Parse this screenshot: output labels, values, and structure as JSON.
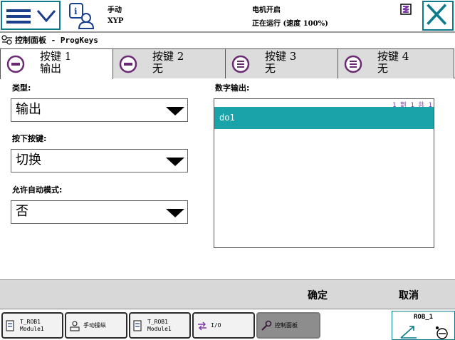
{
  "header": {
    "mode": "手动",
    "tool": "XYP",
    "motor_status": "电机开启",
    "run_status": "正在运行 (速度 100%)"
  },
  "page": {
    "title": "控制面板 - ProgKeys"
  },
  "tabs": [
    {
      "label": "按键 1",
      "value": "输出",
      "active": true
    },
    {
      "label": "按键 2",
      "value": "无",
      "active": false
    },
    {
      "label": "按键 3",
      "value": "无",
      "active": false
    },
    {
      "label": "按键 4",
      "value": "无",
      "active": false
    }
  ],
  "form": {
    "type_label": "类型:",
    "type_value": "输出",
    "press_label": "按下按键:",
    "press_value": "切换",
    "auto_label": "允许自动模式:",
    "auto_value": "否"
  },
  "digital_output": {
    "label": "数字输出:",
    "count": "1 到 1 共 1",
    "items": [
      "do1"
    ]
  },
  "commands": {
    "ok": "确定",
    "cancel": "取消"
  },
  "taskbar": [
    {
      "line1": "T_ROB1",
      "line2": "Module1",
      "icon": "program-icon"
    },
    {
      "line1": "手动操纵",
      "line2": "",
      "icon": "jogging-icon"
    },
    {
      "line1": "T_ROB1",
      "line2": "Module1",
      "icon": "program-icon"
    },
    {
      "line1": "I/O",
      "line2": "",
      "icon": "io-icon"
    },
    {
      "line1": "控制面板",
      "line2": "",
      "icon": "wrench-icon",
      "active": true
    }
  ],
  "robot": {
    "name": "ROB_1"
  },
  "colors": {
    "accent": "#0c7b8c",
    "selection": "#1aa3a8",
    "count_text": "#7b3aa8"
  }
}
